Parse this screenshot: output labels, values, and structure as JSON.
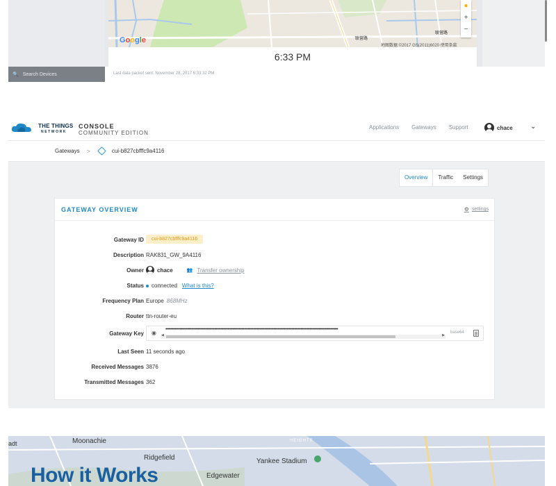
{
  "top_map": {
    "search_label": "Search Devices",
    "time": "6:33 PM",
    "last_packet": "Last data packet sent: November 28, 2017 6:33:32 PM",
    "google": "Google",
    "copyright": "地图数据 ©2017 GS(2011)6020  使用条款",
    "zoom_in": "+",
    "zoom_out": "−",
    "map_labels": [
      "联营路",
      "联营路"
    ]
  },
  "header": {
    "brand_line1": "THE THINGS",
    "brand_line2": "NETWORK",
    "console_title": "CONSOLE",
    "console_sub": "COMMUNITY EDITION",
    "nav": [
      "Applications",
      "Gateways",
      "Support"
    ],
    "username": "chace",
    "brand_color": "#1e88c8"
  },
  "breadcrumb": {
    "root": "Gateways",
    "separator": ">",
    "current": "cui-b827cbfffc9a4116"
  },
  "tabs": [
    "Overview",
    "Traffic",
    "Settings"
  ],
  "overview": {
    "title": "GATEWAY OVERVIEW",
    "settings_link": "settings",
    "labels": {
      "gateway_id": "Gateway ID",
      "description": "Description",
      "owner": "Owner",
      "status": "Status",
      "frequency": "Frequency Plan",
      "router": "Router",
      "gateway_key": "Gateway Key",
      "last_seen": "Last Seen",
      "received": "Received Messages",
      "transmitted": "Transmitted Messages"
    },
    "values": {
      "gateway_id": "cui-b827cbfffc9a4116",
      "description": "RAK831_GW_9A4116",
      "owner": "chace",
      "transfer": "Transfer ownership",
      "status": "connected",
      "what_is_this": "What is this?",
      "frequency": "Europe",
      "frequency_mhz": "868MHz",
      "router": "ttn-router-eu",
      "gateway_key": "••••••••••••••••••••••••••••••••••••••••••••••••••••••••••••••••••••••••••••••••••••••••••••••••••••••••••••••••••••••••••••••••••••••",
      "key_encoding": "base64",
      "last_seen": "11 seconds ago",
      "received": "3876",
      "transmitted": "362"
    },
    "chip_bg": "#fdefc9",
    "chip_color": "#e09b20"
  },
  "bottom": {
    "labels": [
      "Moonachie",
      "Ridgefield",
      "Yankee Stadium",
      "Edgewater",
      "adt",
      "HEIGHTS"
    ],
    "heading": "How it Works"
  }
}
